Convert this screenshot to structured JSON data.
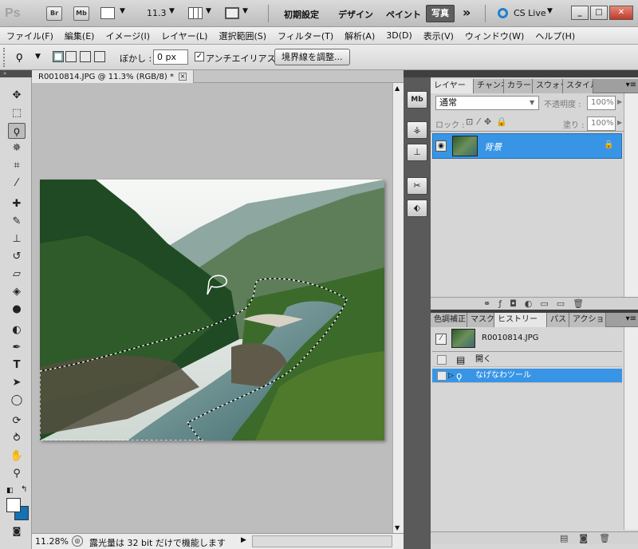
{
  "app_bar": {
    "logo": "Ps",
    "bridge_btn": "Br",
    "minibridge_btn": "Mb",
    "zoom_value": "11.3",
    "workspaces": [
      "初期設定",
      "デザイン",
      "ペイント"
    ],
    "active_workspace": "写真",
    "more": "»",
    "cs_live": "CS Live"
  },
  "menu": [
    "ファイル(F)",
    "編集(E)",
    "イメージ(I)",
    "レイヤー(L)",
    "選択範囲(S)",
    "フィルター(T)",
    "解析(A)",
    "3D(D)",
    "表示(V)",
    "ウィンドウ(W)",
    "ヘルプ(H)"
  ],
  "options": {
    "feather_label": "ぼかし :",
    "feather_value": "0 px",
    "antialias_label": "アンチエイリアス",
    "antialias_checked": true,
    "refine_edge_button": "境界線を調整..."
  },
  "document": {
    "tab_title": "R0010814.JPG @ 11.3% (RGB/8) *",
    "close": "×"
  },
  "status": {
    "zoom": "11.28%",
    "message": "露光量は 32 bit だけで機能します"
  },
  "layers_panel": {
    "tabs": [
      "レイヤー",
      "チャンネル",
      "カラー",
      "スウォッチ",
      "スタイル"
    ],
    "blend_mode": "通常",
    "opacity_label": "不透明度 :",
    "opacity_value": "100%",
    "lock_label": "ロック :",
    "fill_label": "塗り :",
    "fill_value": "100%",
    "layer_name": "背景"
  },
  "history_panel": {
    "tabs": [
      "色調補正",
      "マスク",
      "ヒストリー",
      "パス",
      "アクション"
    ],
    "snapshot": "R0010814.JPG",
    "items": [
      "開く",
      "なげなわツール"
    ]
  },
  "colors": {
    "accent": "#3895e6",
    "background_swatch": "#1472b5"
  }
}
